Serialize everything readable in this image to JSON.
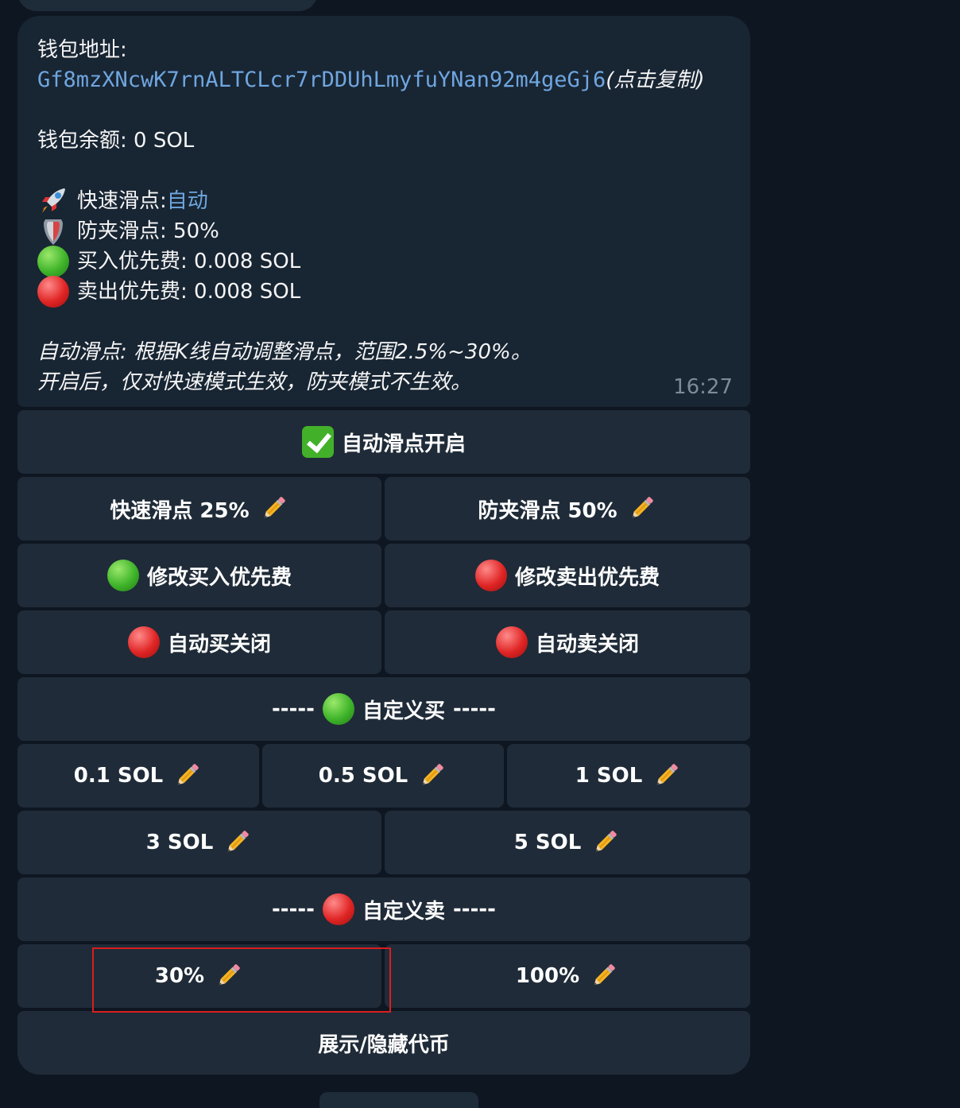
{
  "message": {
    "wallet_address_label": "钱包地址:",
    "wallet_address": "Gf8mzXNcwK7rnALTCLcr7rDDUhLmyfuYNan92m4geGj6",
    "copy_hint": " (点击复制)",
    "balance_text": "钱包余额: 0 SOL",
    "fast_slippage_label": "快速滑点: ",
    "fast_slippage_value": "自动",
    "anti_mev_text": "防夹滑点: 50%",
    "buy_fee_text": "买入优先费:  0.008 SOL",
    "sell_fee_text": "卖出优先费:  0.008 SOL",
    "note_line1": "自动滑点: 根据K线自动调整滑点，范围2.5%~30%。",
    "note_line2": "开启后，仅对快速模式生效，防夹模式不生效。",
    "time": "16:27",
    "icons": [
      "rocket-icon",
      "shield-icon",
      "green-circle-icon",
      "red-circle-icon"
    ]
  },
  "keyboard": {
    "auto_slippage": "自动滑点开启",
    "fast_slippage": "快速滑点 25%",
    "anti_mev_slippage": "防夹滑点 50%",
    "edit_buy_fee": "修改买入优先费",
    "edit_sell_fee": "修改卖出优先费",
    "auto_buy": "自动买关闭",
    "auto_sell": "自动卖关闭",
    "custom_buy_prefix": "-----",
    "custom_buy": "自定义买",
    "custom_buy_suffix": "-----",
    "buy_01": "0.1 SOL",
    "buy_05": "0.5 SOL",
    "buy_1": "1 SOL",
    "buy_3": "3 SOL",
    "buy_5": "5 SOL",
    "custom_sell_prefix": "-----",
    "custom_sell": "自定义卖",
    "custom_sell_suffix": "-----",
    "sell_30": "30%",
    "sell_100": "100%",
    "toggle_tokens": "展示/隐藏代币"
  },
  "colors": {
    "background": "#0e1621",
    "bubble": "#182533",
    "button": "#1f2b38",
    "link": "#6fa6df",
    "highlight": "#d91e1e"
  }
}
